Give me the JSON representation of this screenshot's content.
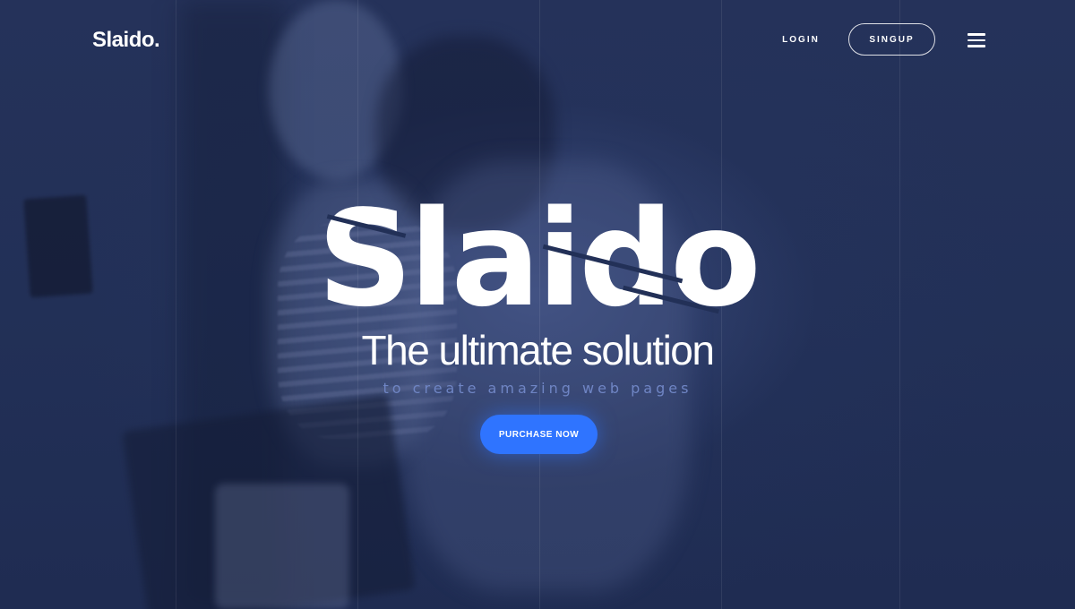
{
  "header": {
    "logo": "Slaido.",
    "login_label": "LOGIN",
    "signup_label": "SINGUP",
    "menu_icon": "hamburger-menu-icon"
  },
  "hero": {
    "title": "Slaido",
    "subtitle": "The ultimate solution",
    "tagline": "to create amazing web pages",
    "cta_label": "PURCHASE NOW"
  },
  "colors": {
    "background": "#223057",
    "accent": "#2f74ff",
    "tagline": "#6f85c4",
    "text": "#ffffff"
  }
}
